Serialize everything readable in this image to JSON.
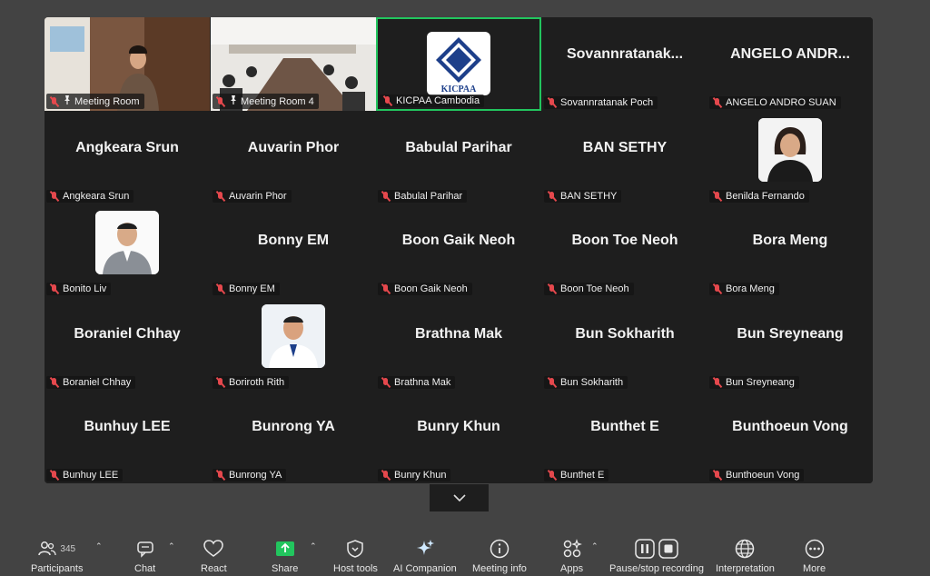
{
  "tiles": [
    {
      "label": "Meeting Room",
      "type": "video",
      "scene": "room1"
    },
    {
      "label": "Meeting Room 4",
      "type": "video",
      "scene": "room2"
    },
    {
      "label": "KICPAA Cambodia",
      "type": "logo",
      "logo_text": "KICPAA",
      "active": true
    },
    {
      "big": "Sovannratanak...",
      "label": "Sovannratanak Poch"
    },
    {
      "big": "ANGELO  ANDR...",
      "label": "ANGELO ANDRO SUAN"
    },
    {
      "big": "Angkeara Srun",
      "label": "Angkeara Srun"
    },
    {
      "big": "Auvarin Phor",
      "label": "Auvarin Phor"
    },
    {
      "big": "Babulal Parihar",
      "label": "Babulal Parihar"
    },
    {
      "big": "BAN SETHY",
      "label": "BAN SETHY"
    },
    {
      "label": "Benilda Fernando",
      "type": "photo",
      "photo": "female"
    },
    {
      "label": "Bonito Liv",
      "type": "photo",
      "photo": "male-gray"
    },
    {
      "big": "Bonny EM",
      "label": "Bonny EM"
    },
    {
      "big": "Boon Gaik Neoh",
      "label": "Boon Gaik Neoh"
    },
    {
      "big": "Boon Toe Neoh",
      "label": "Boon Toe Neoh"
    },
    {
      "big": "Bora Meng",
      "label": "Bora Meng"
    },
    {
      "big": "Boraniel Chhay",
      "label": "Boraniel Chhay"
    },
    {
      "label": "Boriroth Rith",
      "type": "photo",
      "photo": "male-white"
    },
    {
      "big": "Brathna Mak",
      "label": "Brathna Mak"
    },
    {
      "big": "Bun Sokharith",
      "label": "Bun Sokharith"
    },
    {
      "big": "Bun Sreyneang",
      "label": "Bun Sreyneang"
    },
    {
      "big": "Bunhuy LEE",
      "label": "Bunhuy LEE"
    },
    {
      "big": "Bunrong YA",
      "label": "Bunrong YA"
    },
    {
      "big": "Bunry Khun",
      "label": "Bunry Khun"
    },
    {
      "big": "Bunthet E",
      "label": "Bunthet E"
    },
    {
      "big": "Bunthoeun Vong",
      "label": "Bunthoeun Vong"
    }
  ],
  "toolbar": {
    "participants": {
      "label": "Participants",
      "count": "345"
    },
    "chat": {
      "label": "Chat"
    },
    "react": {
      "label": "React"
    },
    "share": {
      "label": "Share"
    },
    "host_tools": {
      "label": "Host tools"
    },
    "ai_companion": {
      "label": "AI Companion"
    },
    "meeting_info": {
      "label": "Meeting info"
    },
    "apps": {
      "label": "Apps"
    },
    "recording": {
      "label": "Pause/stop recording"
    },
    "interpretation": {
      "label": "Interpretation"
    },
    "more": {
      "label": "More"
    }
  },
  "colors": {
    "active_border": "#22c55e",
    "share_green": "#22c55e",
    "muted_red": "#e5484d"
  }
}
